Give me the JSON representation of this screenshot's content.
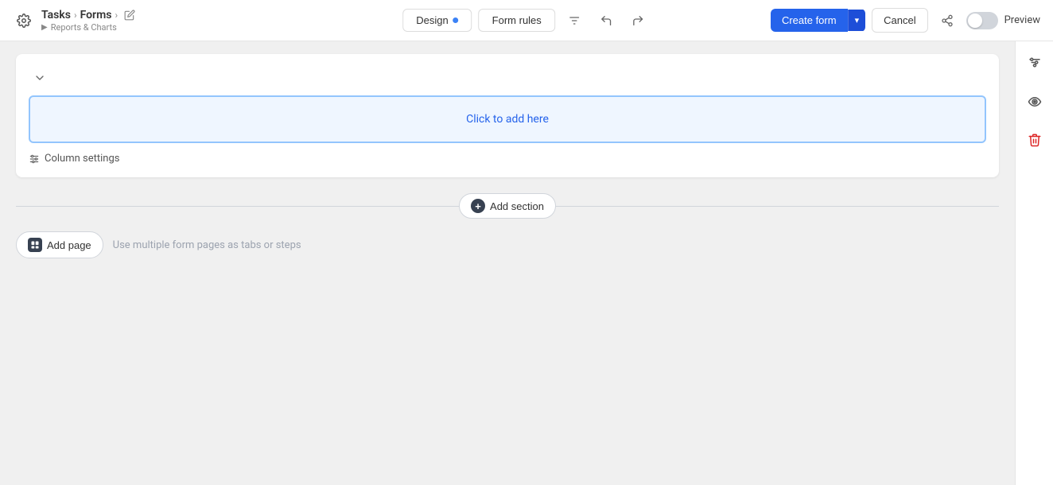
{
  "topbar": {
    "gear_label": "⚙",
    "breadcrumb": {
      "parent": "Tasks",
      "sep1": "›",
      "current": "Forms",
      "sep2": "›",
      "edit_icon": "✎",
      "sub_arrow": "▶",
      "sub_label": "Reports & Charts"
    },
    "tabs": [
      {
        "id": "design",
        "label": "Design",
        "active": true,
        "dot": true
      },
      {
        "id": "form-rules",
        "label": "Form rules",
        "active": false,
        "dot": false
      }
    ],
    "actions": {
      "filter_icon": "⧉",
      "undo_icon": "↩",
      "redo_icon": "↪",
      "create_form_label": "Create form",
      "dropdown_arrow": "▾",
      "cancel_label": "Cancel",
      "share_icon": "⤴"
    },
    "toggle": {
      "preview_label": "Preview"
    }
  },
  "form": {
    "collapse_icon": "∨",
    "click_to_add_text": "Click to add here",
    "column_settings_label": "Column settings"
  },
  "divider": {
    "add_section_label": "Add section",
    "add_section_plus": "+"
  },
  "add_page": {
    "label": "Add page",
    "plus": "+",
    "hint": "Use multiple form pages as tabs or steps"
  },
  "right_sidebar": {
    "filter_icon": "≡",
    "eye_icon": "◎",
    "trash_icon": "🗑"
  }
}
